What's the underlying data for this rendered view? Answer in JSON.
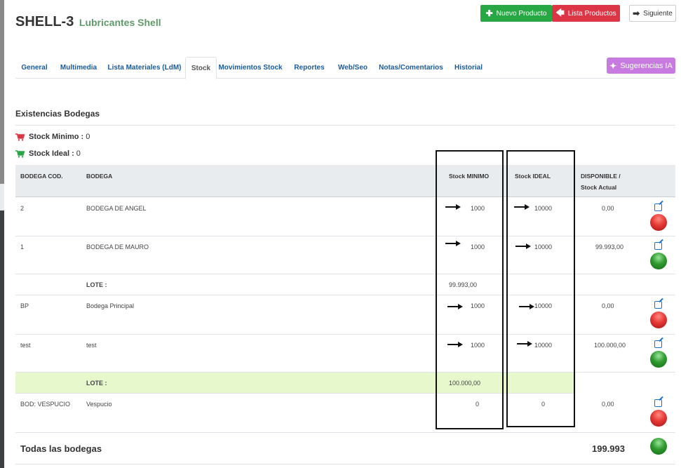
{
  "header": {
    "product_code": "SHELL-3",
    "product_name": "Lubricantes Shell"
  },
  "buttons": {
    "new_product": "Nuevo Producto",
    "product_list": "Lista Productos",
    "next": "Siguiente",
    "ai_suggestions": "Sugerencias IA"
  },
  "tabs": [
    {
      "label": "General"
    },
    {
      "label": "Multimedia"
    },
    {
      "label": "Lista Materiales (LdM)"
    },
    {
      "label": "Stock",
      "active": true
    },
    {
      "label": "Movimientos Stock"
    },
    {
      "label": "Reportes"
    },
    {
      "label": "Web/Seo"
    },
    {
      "label": "Notas/Comentarios"
    },
    {
      "label": "Historial"
    }
  ],
  "section": {
    "title": "Existencias Bodegas",
    "stock_minimo_label": "Stock Minimo :",
    "stock_minimo_value": "0",
    "stock_ideal_label": "Stock Ideal :",
    "stock_ideal_value": "0"
  },
  "table": {
    "headers": {
      "code": "BODEGA COD.",
      "name": "BODEGA",
      "min": "Stock MINIMO",
      "ideal": "Stock IDEAL",
      "available_line1": "DISPONIBLE /",
      "available_line2": "Stock Actual"
    },
    "rows": [
      {
        "code": "2",
        "name": "BODEGA DE ANGEL",
        "min": "1000",
        "ideal": "10000",
        "available": "0,00",
        "status": "red"
      },
      {
        "code": "1",
        "name": "BODEGA DE MAURO",
        "min": "1000",
        "ideal": "10000",
        "available": "99.993,00",
        "status": "green"
      },
      {
        "lote_label": "LOTE :",
        "lote_value": "99.993,00"
      },
      {
        "code": "BP",
        "name": "Bodega Principal",
        "min": "1000",
        "ideal": "10000",
        "available": "0,00",
        "status": "red"
      },
      {
        "code": "test",
        "name": "test",
        "min": "1000",
        "ideal": "10000",
        "available": "100.000,00",
        "status": "green"
      },
      {
        "lote_label": "LOTE :",
        "lote_value": "100.000,00"
      },
      {
        "code": "BOD: VESPUCIO",
        "name": "Vespucio",
        "min": "0",
        "ideal": "0",
        "available": "0,00",
        "status": "red"
      }
    ],
    "total_label": "Todas las bodegas",
    "total_value": "199.993",
    "total_status": "green"
  },
  "colors": {
    "accent_green": "#28a745",
    "accent_red": "#dc3545",
    "ai_purple": "#c77be0",
    "tab_link": "#1a5a9c",
    "lote_highlight": "#e6f8cc"
  }
}
